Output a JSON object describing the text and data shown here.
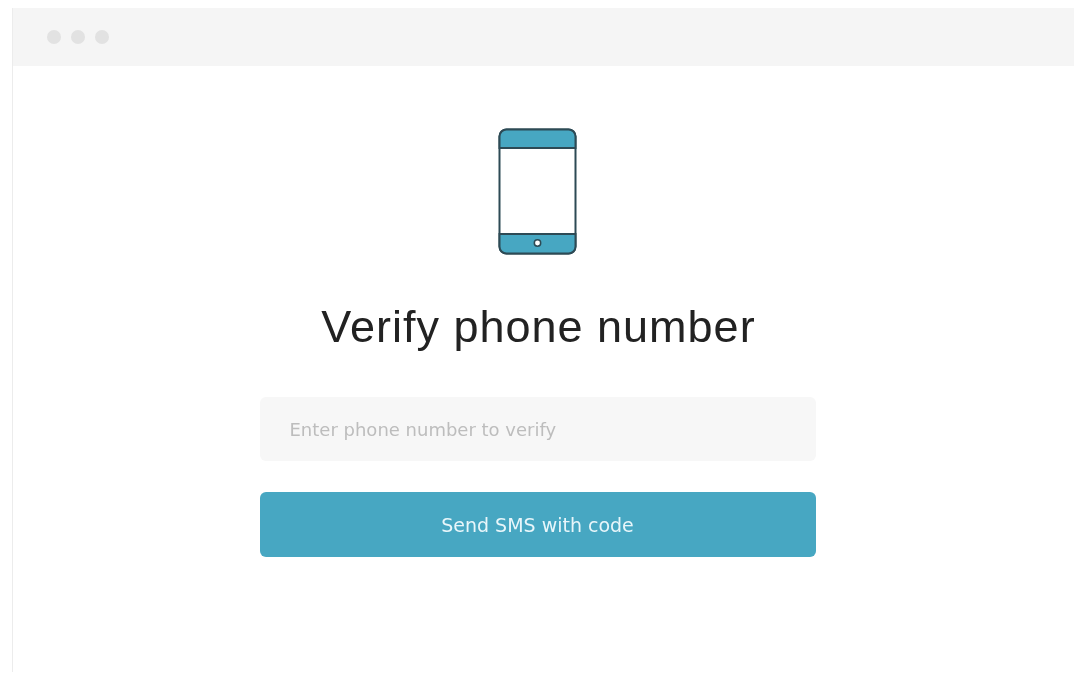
{
  "heading": "Verify phone number",
  "phone_field": {
    "placeholder": "Enter phone number to verify"
  },
  "send_button": {
    "label": "Send SMS with code"
  }
}
